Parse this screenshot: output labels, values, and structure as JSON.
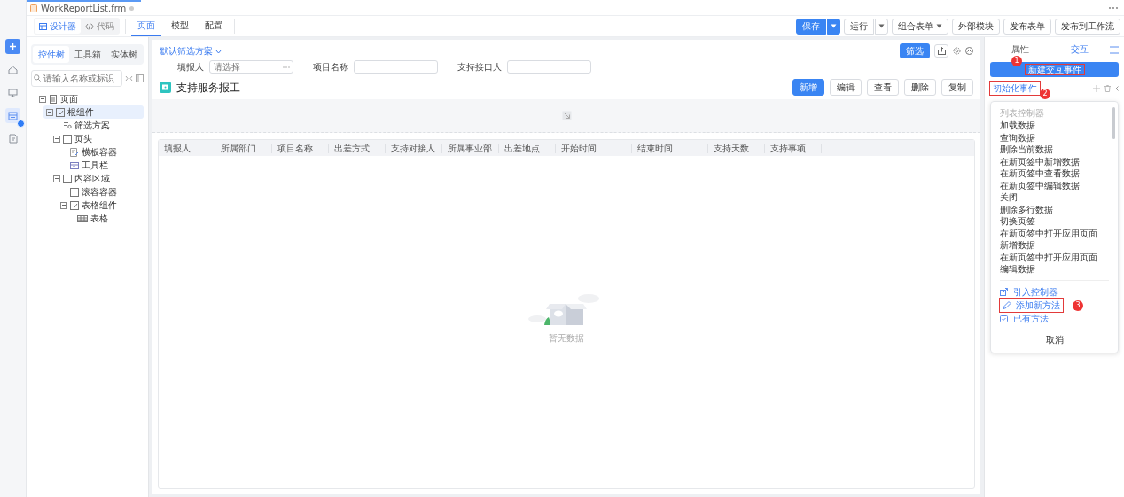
{
  "file_tab": {
    "title": "WorkReportList.frm",
    "modified": true
  },
  "rail": [
    {
      "selected": false,
      "badge": false
    },
    {
      "selected": false,
      "badge": false
    },
    {
      "selected": false,
      "badge": false
    },
    {
      "selected": true,
      "badge": true
    },
    {
      "selected": false,
      "badge": false
    }
  ],
  "view_switch": [
    {
      "label": "设计器",
      "selected": true
    },
    {
      "label": "代码",
      "selected": false
    }
  ],
  "tabs": [
    {
      "label": "页面",
      "selected": true
    },
    {
      "label": "模型",
      "selected": false
    },
    {
      "label": "配置",
      "selected": false
    }
  ],
  "actions": [
    {
      "label": "保存",
      "primary": true,
      "kind": "split"
    },
    {
      "label": "运行",
      "primary": false,
      "kind": "split"
    },
    {
      "label": "组合表单",
      "primary": false,
      "kind": "dropdown"
    },
    {
      "label": "外部模块",
      "primary": false,
      "kind": "plain"
    },
    {
      "label": "发布表单",
      "primary": false,
      "kind": "plain"
    },
    {
      "label": "发布到工作流",
      "primary": false,
      "kind": "plain"
    }
  ],
  "left_panel": {
    "tabs": [
      {
        "label": "控件树",
        "selected": true
      },
      {
        "label": "工具箱",
        "selected": false
      },
      {
        "label": "实体树",
        "selected": false
      }
    ],
    "search": {
      "placeholder": "请输入名称或标识"
    },
    "tree": [
      {
        "label": "页面",
        "kind": "page",
        "selected": false,
        "expanded": true,
        "children": [
          {
            "label": "根组件",
            "kind": "component",
            "selected": true,
            "expanded": true,
            "children": [
              {
                "label": "筛选方案",
                "kind": "filter",
                "selected": false
              },
              {
                "label": "页头",
                "kind": "frame",
                "selected": false,
                "expanded": true,
                "children": [
                  {
                    "label": "横板容器",
                    "kind": "form",
                    "selected": false
                  },
                  {
                    "label": "工具栏",
                    "kind": "toolbar",
                    "selected": false
                  }
                ]
              },
              {
                "label": "内容区域",
                "kind": "frame",
                "selected": false,
                "expanded": true,
                "children": [
                  {
                    "label": "滚容容器",
                    "kind": "frame",
                    "selected": false
                  },
                  {
                    "label": "表格组件",
                    "kind": "component",
                    "selected": false,
                    "expanded": true,
                    "children": [
                      {
                        "label": "表格",
                        "kind": "table",
                        "selected": false
                      }
                    ]
                  }
                ]
              }
            ]
          }
        ]
      }
    ]
  },
  "canvas": {
    "filter_scheme": "默认筛选方案",
    "filter_button": "筛选",
    "filters": [
      {
        "label": "填报人",
        "kind": "lookup",
        "placeholder": "请选择"
      },
      {
        "label": "项目名称",
        "kind": "text"
      },
      {
        "label": "支持接口人",
        "kind": "text"
      }
    ],
    "title": "支持服务报工",
    "buttons": [
      {
        "label": "新增",
        "primary": true
      },
      {
        "label": "编辑",
        "primary": false
      },
      {
        "label": "查看",
        "primary": false
      },
      {
        "label": "删除",
        "primary": false
      },
      {
        "label": "复制",
        "primary": false
      }
    ],
    "table": {
      "columns": [
        "填报人",
        "所属部门",
        "项目名称",
        "出差方式",
        "支持对接人",
        "所属事业部",
        "出差地点",
        "开始时间",
        "结束时间",
        "支持天数",
        "支持事项"
      ]
    },
    "empty_text": "暂无数据"
  },
  "right_panel": {
    "tabs": [
      {
        "label": "属性",
        "selected": false
      },
      {
        "label": "交互",
        "selected": true
      }
    ],
    "new_event_button": {
      "label": "新建交互事件",
      "callout": "1"
    },
    "event": {
      "label": "初始化事件",
      "callout": "2"
    },
    "menu": {
      "group_title": "列表控制器",
      "items": [
        "加载数据",
        "查询数据",
        "删除当前数据",
        "在新页签中新增数据",
        "在新页签中查看数据",
        "在新页签中编辑数据",
        "关闭",
        "删除多行数据",
        "切换页签",
        "在新页签中打开应用页面新增数据",
        "在新页签中打开应用页面编辑数据"
      ],
      "actions": [
        {
          "label": "引入控制器"
        },
        {
          "label": "添加新方法",
          "callout": "3"
        },
        {
          "label": "已有方法"
        }
      ],
      "cancel": "取消"
    }
  }
}
